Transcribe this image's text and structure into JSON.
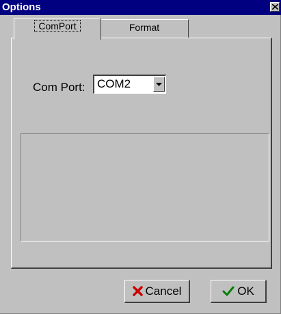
{
  "window": {
    "title": "Options"
  },
  "tabs": [
    {
      "label": "ComPort",
      "selected": true
    },
    {
      "label": "Format",
      "selected": false
    }
  ],
  "comport": {
    "label": "Com Port:",
    "value": "COM2"
  },
  "buttons": {
    "cancel": "Cancel",
    "ok": "OK"
  },
  "icons": {
    "close": "close-icon",
    "dropdown": "chevron-down-icon",
    "cancel": "x-icon",
    "ok": "check-icon"
  },
  "colors": {
    "title_bar": "#000080",
    "face": "#c0c0c0",
    "cancel_icon": "#cc0000",
    "ok_icon": "#008000"
  }
}
